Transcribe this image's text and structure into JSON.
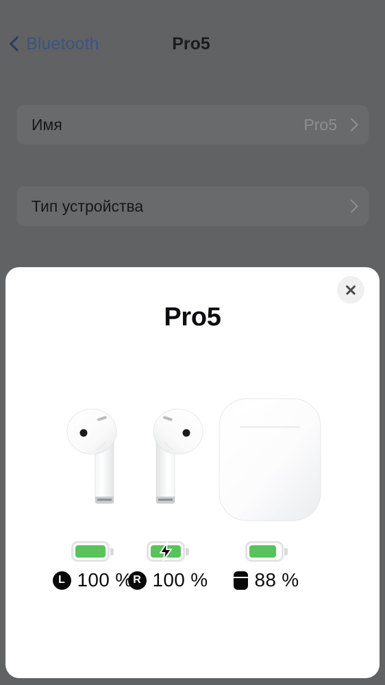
{
  "nav": {
    "back_label": "Bluetooth",
    "back_icon": "chevron-left-icon",
    "title": "Pro5"
  },
  "settings": {
    "rows": [
      {
        "label": "Имя",
        "value": "Pro5",
        "chevron": "chevron-right-icon"
      },
      {
        "label": "Тип устройства",
        "value": "",
        "chevron": "chevron-right-icon"
      }
    ]
  },
  "sheet": {
    "title": "Pro5",
    "close_icon": "close-icon",
    "devices": [
      {
        "name": "left-airpod-image"
      },
      {
        "name": "right-airpod-image"
      },
      {
        "name": "charging-case-image"
      }
    ],
    "batteries": [
      {
        "id": "left",
        "badge": "L",
        "badge_icon": "left-earbud-badge-icon",
        "percent": 100,
        "percent_text": "100 %",
        "charging": false,
        "fill_color": "#58c35a"
      },
      {
        "id": "right",
        "badge": "R",
        "badge_icon": "right-earbud-badge-icon",
        "percent": 100,
        "percent_text": "100 %",
        "charging": true,
        "charging_icon": "lightning-bolt-icon",
        "fill_color": "#58c35a"
      },
      {
        "id": "case",
        "badge": "",
        "badge_icon": "case-badge-icon",
        "percent": 88,
        "percent_text": "88 %",
        "charging": false,
        "fill_color": "#58c35a"
      }
    ]
  },
  "colors": {
    "backdrop": "#616263",
    "sheet": "#ffffff",
    "accent_link": "#3c5481",
    "battery_green": "#58c35a"
  }
}
